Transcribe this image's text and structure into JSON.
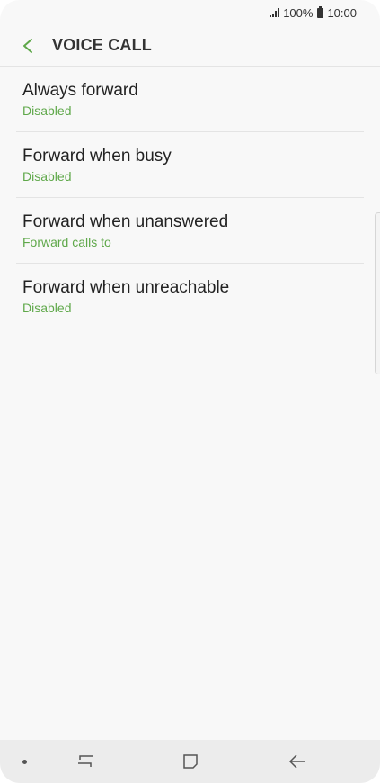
{
  "status_bar": {
    "battery_text": "100%",
    "time": "10:00"
  },
  "header": {
    "title": "VOICE CALL"
  },
  "items": [
    {
      "title": "Always forward",
      "subtitle": "Disabled"
    },
    {
      "title": "Forward when busy",
      "subtitle": "Disabled"
    },
    {
      "title": "Forward when unanswered",
      "subtitle": "Forward calls to"
    },
    {
      "title": "Forward when unreachable",
      "subtitle": "Disabled"
    }
  ],
  "colors": {
    "accent": "#5fa84a",
    "background": "#f8f8f8",
    "text": "#222222",
    "nav_bar": "#ececec"
  },
  "icons": {
    "back": "back-arrow-icon",
    "signal": "signal-icon",
    "battery": "battery-icon",
    "recent_apps": "recent-apps-icon",
    "home": "home-icon",
    "nav_back": "nav-back-icon"
  }
}
